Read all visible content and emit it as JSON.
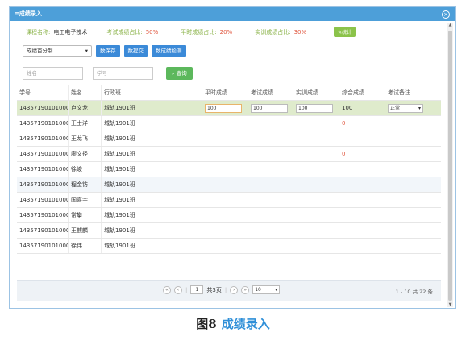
{
  "window": {
    "title": "≡成绩录入",
    "close": "×"
  },
  "info": {
    "course_label": "课程名称:",
    "course_value": "电工电子技术",
    "exam_label": "考试成绩占比:",
    "exam_value": "50%",
    "usual_label": "平时成绩占比:",
    "usual_value": "20%",
    "practice_label": "实训成绩占比:",
    "practice_value": "30%",
    "stats_button": "✎统计"
  },
  "toolbar": {
    "mode_select": "成绩百分制",
    "save": "数保存",
    "submit": "数提交",
    "check": "数成绩检测"
  },
  "filters": {
    "name_placeholder": "姓名",
    "id_placeholder": "学号",
    "query": "查询"
  },
  "table": {
    "headers": [
      "学号",
      "姓名",
      "行政班",
      "平时成绩",
      "考试成绩",
      "实训成绩",
      "综合成绩",
      "考试备注"
    ],
    "rows": [
      {
        "id": "1435719010100001",
        "name": "卢文龙",
        "cls": "城轨1901班",
        "usual": "100",
        "exam": "100",
        "practice": "100",
        "total": "100",
        "remark": "正常"
      },
      {
        "id": "1435719010100002",
        "name": "王士洋",
        "cls": "城轨1901班",
        "usual": "",
        "exam": "",
        "practice": "",
        "total": "0",
        "remark": ""
      },
      {
        "id": "1435719010100003",
        "name": "王龙飞",
        "cls": "城轨1901班",
        "usual": "",
        "exam": "",
        "practice": "",
        "total": "",
        "remark": ""
      },
      {
        "id": "1435719010100004",
        "name": "廖文径",
        "cls": "城轨1901班",
        "usual": "",
        "exam": "",
        "practice": "",
        "total": "0",
        "remark": ""
      },
      {
        "id": "1435719010100005",
        "name": "徐峻",
        "cls": "城轨1901班",
        "usual": "",
        "exam": "",
        "practice": "",
        "total": "",
        "remark": ""
      },
      {
        "id": "1435719010100006",
        "name": "程金钫",
        "cls": "城轨1901班",
        "usual": "",
        "exam": "",
        "practice": "",
        "total": "",
        "remark": ""
      },
      {
        "id": "1435719010100008",
        "name": "国喜宇",
        "cls": "城轨1901班",
        "usual": "",
        "exam": "",
        "practice": "",
        "total": "",
        "remark": ""
      },
      {
        "id": "1435719010100009",
        "name": "常攀",
        "cls": "城轨1901班",
        "usual": "",
        "exam": "",
        "practice": "",
        "total": "",
        "remark": ""
      },
      {
        "id": "1435719010100010",
        "name": "王麒麟",
        "cls": "城轨1901班",
        "usual": "",
        "exam": "",
        "practice": "",
        "total": "",
        "remark": ""
      },
      {
        "id": "1435719010100011",
        "name": "徐伟",
        "cls": "城轨1901班",
        "usual": "",
        "exam": "",
        "practice": "",
        "total": "",
        "remark": ""
      }
    ]
  },
  "pager": {
    "first": "«",
    "prev": "‹",
    "page": "1",
    "total_pages": "共3页",
    "next": "›",
    "last": "»",
    "page_size": "10",
    "range": "1 - 10   共 22 条"
  },
  "caption": {
    "prefix": "图8",
    "title": "成绩录入"
  }
}
